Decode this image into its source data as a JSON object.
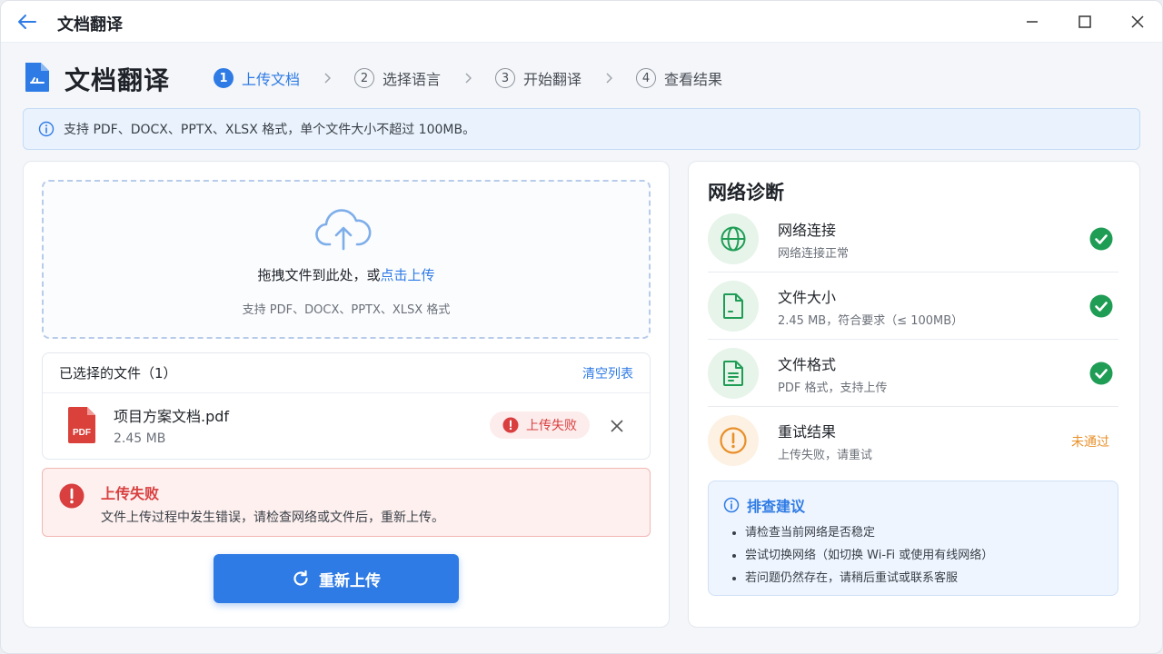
{
  "window": {
    "title": "文档翻译"
  },
  "header": {
    "title": "文档翻译"
  },
  "steps": [
    {
      "num": "1",
      "label": "上传文档",
      "active": true
    },
    {
      "num": "2",
      "label": "选择语言",
      "active": false
    },
    {
      "num": "3",
      "label": "开始翻译",
      "active": false
    },
    {
      "num": "4",
      "label": "查看结果",
      "active": false
    }
  ],
  "info_banner": {
    "text": "支持 PDF、DOCX、PPTX、XLSX 格式，单个文件大小不超过 100MB。"
  },
  "dropzone": {
    "text_prefix": "拖拽文件到此处，或",
    "link": "点击上传",
    "subtext": "支持 PDF、DOCX、PPTX、XLSX 格式"
  },
  "file_list": {
    "title": "已选择的文件（1）",
    "clear_label": "清空列表",
    "files": [
      {
        "icon_label": "PDF",
        "name": "项目方案文档.pdf",
        "size": "2.45 MB",
        "status": "上传失败"
      }
    ]
  },
  "error_alert": {
    "title": "上传失败",
    "message": "文件上传过程中发生错误，请检查网络或文件后，重新上传。"
  },
  "retry_button": {
    "label": "重新上传"
  },
  "diagnostics": {
    "title": "网络诊断",
    "items": [
      {
        "name": "网络连接",
        "desc": "网络连接正常",
        "status": "ok",
        "icon": "globe-icon"
      },
      {
        "name": "文件大小",
        "desc": "2.45 MB，符合要求（≤ 100MB）",
        "status": "ok",
        "icon": "file-icon"
      },
      {
        "name": "文件格式",
        "desc": "PDF 格式，支持上传",
        "status": "ok",
        "icon": "document-icon"
      },
      {
        "name": "重试结果",
        "desc": "上传失败，请重试",
        "status": "fail",
        "status_text": "未通过",
        "icon": "warning-icon"
      }
    ]
  },
  "tips": {
    "title": "排查建议",
    "items": [
      "请检查当前网络是否稳定",
      "尝试切换网络（如切换 Wi-Fi 或使用有线网络）",
      "若问题仍然存在，请稍后重试或联系客服"
    ]
  },
  "colors": {
    "primary": "#2f7be5",
    "success": "#1f9d55",
    "error": "#d93f3f",
    "warning": "#e8902a"
  }
}
